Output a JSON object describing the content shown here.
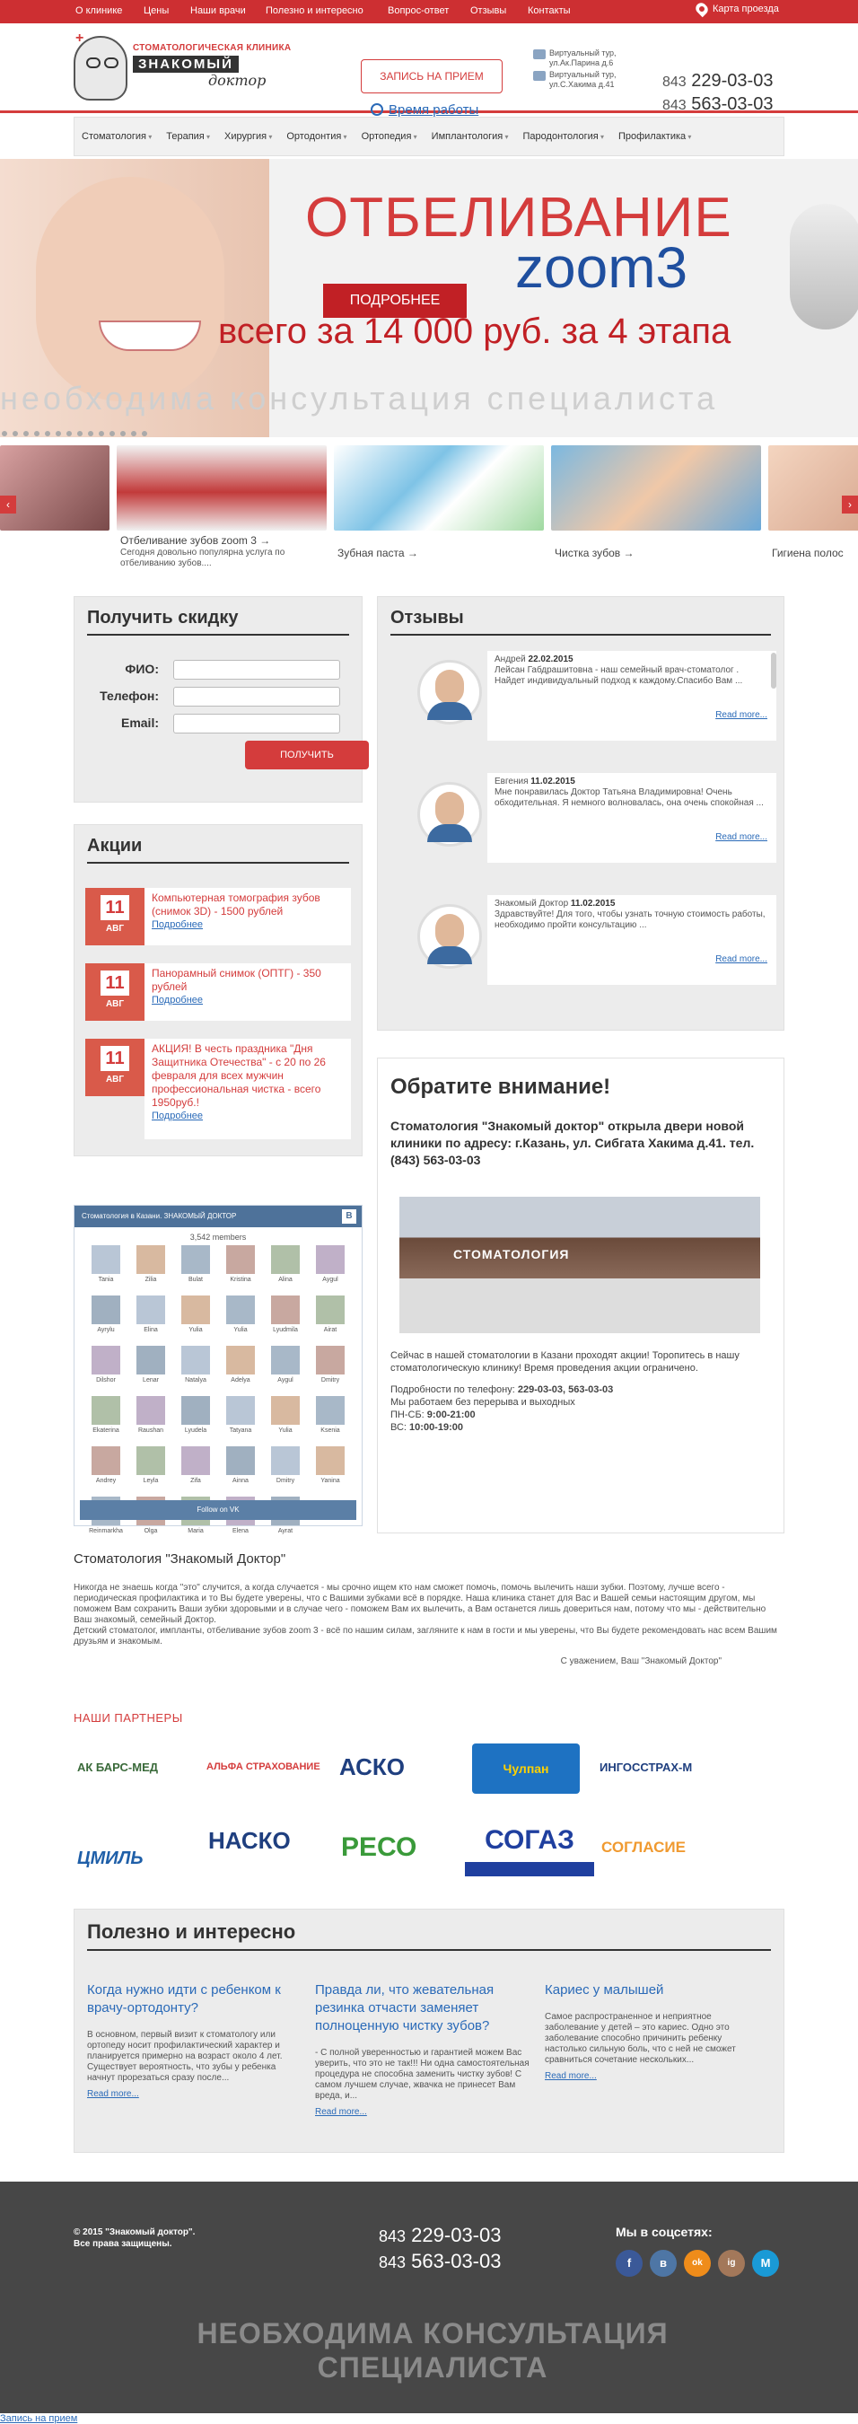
{
  "topbar": {
    "links": [
      "О клинике",
      "Цены",
      "Наши врачи",
      "Полезно и интересно",
      "Вопрос-ответ",
      "Отзывы",
      "Контакты"
    ],
    "map_label": "Карта проезда"
  },
  "header": {
    "logo_line1": "СТОМАТОЛОГИЧЕСКАЯ КЛИНИКА",
    "logo_line2": "ЗНАКОМЫЙ",
    "logo_line3": "доктор",
    "appointment_button": "ЗАПИСЬ НА ПРИЕМ",
    "worktime_link": "Время работы",
    "tour1": "Виртуальный тур, ул.Ак.Парина д.6",
    "tour2": "Виртуальный тур, ул.С.Хакима д.41",
    "phone1_code": "843",
    "phone1": "229-03-03",
    "phone2_code": "843",
    "phone2": "563-03-03"
  },
  "nav": [
    "Стоматология",
    "Терапия",
    "Хирургия",
    "Ортодонтия",
    "Ортопедия",
    "Имплантология",
    "Пародонтология",
    "Профилактика"
  ],
  "hero": {
    "title1": "ОТБЕЛИВАНИЕ",
    "title2": "zoom3",
    "more_button": "ПОДРОБНЕЕ",
    "price": "всего за 14 000 руб. за 4 этапа",
    "consult": "необходима консультация специалиста"
  },
  "carousel": [
    {
      "caption": "",
      "desc": ""
    },
    {
      "caption": "Отбеливание зубов zoom 3 →",
      "desc": "Сегодня довольно популярна услуга по отбеливанию зубов...."
    },
    {
      "caption": "Зубная паста →",
      "desc": ""
    },
    {
      "caption": "Чистка зубов →",
      "desc": ""
    },
    {
      "caption": "Гигиена полос",
      "desc": ""
    }
  ],
  "discount": {
    "title": "Получить скидку",
    "fio_label": "ФИО:",
    "phone_label": "Телефон:",
    "email_label": "Email:",
    "submit": "ПОЛУЧИТЬ"
  },
  "actions": {
    "title": "Акции",
    "items": [
      {
        "day": "11",
        "month": "АВГ",
        "text": "Компьютерная томография зубов (снимок 3D) - 1500 рублей",
        "link": "Подробнее"
      },
      {
        "day": "11",
        "month": "АВГ",
        "text": "Панорамный снимок (ОПТГ) - 350 рублей",
        "link": "Подробнее"
      },
      {
        "day": "11",
        "month": "АВГ",
        "text": "АКЦИЯ! В честь праздника \"Дня Защитника Отечества\" - с 20 по 26 февраля для всех мужчин профессиональная чистка - всего 1950руб.!",
        "link": "Подробнее"
      }
    ]
  },
  "reviews": {
    "title": "Отзывы",
    "items": [
      {
        "author": "Андрей",
        "date": "22.02.2015",
        "text": "Лейсан Габдрашитовна - наш семейный врач-стоматолог . Найдет индивидуальный подход к каждому.Спасибо Вам ...",
        "more": "Read more..."
      },
      {
        "author": "Евгения",
        "date": "11.02.2015",
        "text": "Мне понравилась Доктор Татьяна Владимировна! Очень обходительная. Я немного волновалась, она очень спокойная ...",
        "more": "Read more..."
      },
      {
        "author": "Знакомый Доктор",
        "date": "11.02.2015",
        "text": "Здравствуйте! Для того, чтобы узнать точную стоимость работы, необходимо пройти консультацию ...",
        "more": "Read more..."
      }
    ]
  },
  "attention": {
    "title": "Обратите внимание!",
    "lead": "Стоматология \"Знакомый доктор\" открыла двери новой клиники по адресу: г.Казань, ул. Сибгата Хакима д.41. тел. (843) 563-03-03",
    "sign": "СТОМАТОЛОГИЯ",
    "p1": "Сейчас в нашей стоматологии в Казани проходят акции! Торопитесь в нашу стоматологическую клинику! Время проведения акции ограничено.",
    "p2": "Подробности по телефону:",
    "p2_phones": "229-03-03, 563-03-03",
    "p3": "Мы работаем без перерыва и выходных",
    "p4_label": "ПН-СБ:",
    "p4_value": "9:00-21:00",
    "p5_label": "ВС:",
    "p5_value": "10:00-19:00"
  },
  "vk": {
    "title": "Стоматология в Казани. ЗНАКОМЫЙ ДОКТОР",
    "logo": "В",
    "members": "3,542 members",
    "names": [
      "Tania",
      "Zilia",
      "Bulat",
      "Kristina",
      "Alina",
      "Aygul",
      "Ayrylu",
      "Elina",
      "Yulia",
      "Yulia",
      "Lyudmila",
      "Airat",
      "Dilshor",
      "Lenar",
      "Natalya",
      "Adelya",
      "Aygul",
      "Dmitry",
      "Ekaterina",
      "Raushan",
      "Lyudela",
      "Tatyana",
      "Yulia",
      "Ksenia",
      "Andrey",
      "Leyla",
      "Zifa",
      "Ainna",
      "Dmitry",
      "Yanina",
      "Reinmarkha",
      "Olga",
      "Maria",
      "Elena",
      "Ayrat"
    ],
    "follow": "Follow on VK"
  },
  "about": {
    "title": "Стоматология \"Знакомый Доктор\"",
    "text": "Никогда не знаешь когда \"это\" случится, а когда случается - мы срочно ищем кто нам сможет помочь, помочь вылечить наши зубки. Поэтому, лучше всего - периодическая профилактика и то Вы будете уверены, что с Вашими зубками всё в порядке. Наша клиника станет для Вас и Вашей семьи настоящим другом, мы поможем Вам сохранить Ваши зубки здоровыми и в случае чего - поможем Вам их вылечить, а Вам останется лишь довериться нам, потому что мы - действительно Ваш знакомый, семейный Доктор.",
    "text2": "Детский стоматолог, импланты, отбеливание зубов zoom 3 - всё по нашим силам, загляните к нам в гости и мы уверены, что Вы будете рекомендовать нас всем Вашим друзьям и знакомым.",
    "sign": "С уважением, Ваш \"Знакомый Доктор\""
  },
  "partners": {
    "title": "НАШИ ПАРТНЕРЫ",
    "logos": [
      "АК БАРС-МЕД",
      "АЛЬФА СТРАХОВАНИЕ",
      "АСКО",
      "Чулпан",
      "ИНГОССТРАХ-М",
      "ЦМИЛЬ",
      "НАСКО",
      "РЕСО",
      "СОГАЗ",
      "СОГЛАСИЕ"
    ]
  },
  "useful": {
    "title": "Полезно и интересно",
    "items": [
      {
        "title": "Когда нужно идти с ребенком к врачу-ортодонту?",
        "text": "В основном, первый визит к стоматологу или ортопеду носит профилактический характер и планируется примерно на возраст около 4 лет. Существует вероятность, что зубы у ребенка начнут прорезаться сразу после...",
        "more": "Read more..."
      },
      {
        "title": "Правда ли, что жевательная резинка отчасти заменяет полноценную чистку зубов?",
        "text": "- С полной уверенностью и гарантией можем Вас уверить, что это не так!!! Ни одна самостоятельная процедура не способна заменить чистку зубов! С самом лучшем случае, жвачка не принесет Вам вреда, и...",
        "more": "Read more..."
      },
      {
        "title": "Кариес у малышей",
        "text": "Самое распространенное и неприятное заболевание у детей – это кариес. Одно это заболевание способно причинить ребенку настолько сильную боль, что с ней не сможет сравниться сочетание нескольких...",
        "more": "Read more..."
      }
    ]
  },
  "footer": {
    "copyright1": "© 2015 \"Знакомый доктор\".",
    "copyright2": "Все права защищены.",
    "phone1_code": "843",
    "phone1": "229-03-03",
    "phone2_code": "843",
    "phone2": "563-03-03",
    "social_title": "Мы в соцсетях:",
    "social_icons": [
      "f",
      "в",
      "ok",
      "ig",
      "М"
    ],
    "consult": "НЕОБХОДИМА КОНСУЛЬТАЦИЯ СПЕЦИАЛИСТА"
  },
  "bottom_link": "Запись на прием"
}
